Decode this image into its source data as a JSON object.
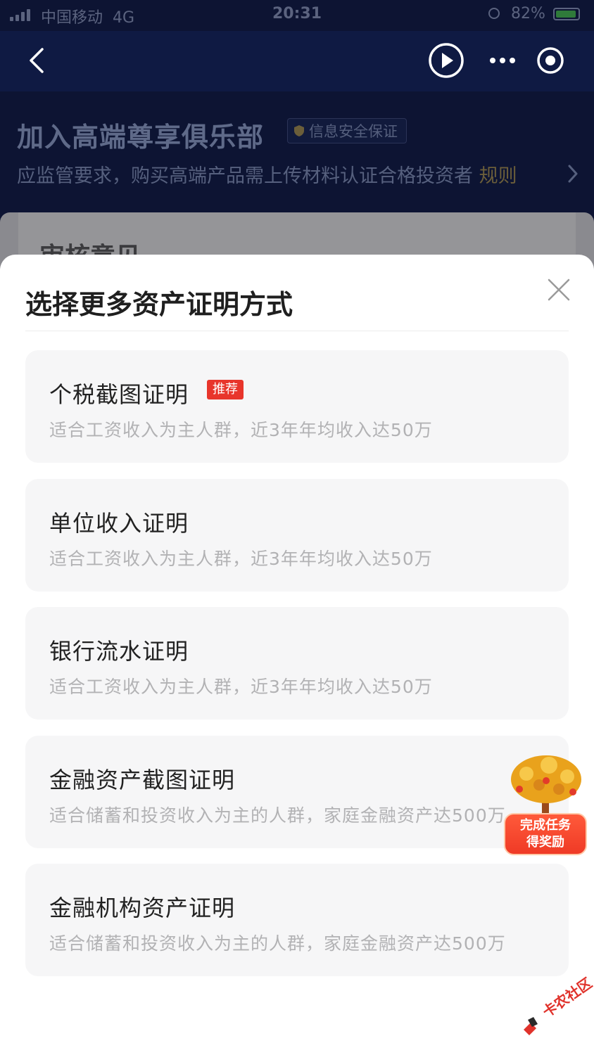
{
  "status_bar": {
    "carrier": "中国移动",
    "network": "4G",
    "time": "20:31",
    "battery": "82%"
  },
  "nav": {
    "icons": [
      "back-icon",
      "play-icon",
      "more-icon",
      "target-icon"
    ]
  },
  "header": {
    "title": "加入高端尊享俱乐部",
    "badge": "信息安全保证",
    "subtitle": "应监管要求，购买高端产品需上传材料认证合格投资者",
    "rules_link": "规则"
  },
  "background_card": {
    "title": "审核意见"
  },
  "sheet": {
    "title": "选择更多资产证明方式",
    "options": [
      {
        "title": "个税截图证明",
        "tag": "推荐",
        "desc": "适合工资收入为主人群，近3年年均收入达50万"
      },
      {
        "title": "单位收入证明",
        "desc": "适合工资收入为主人群，近3年年均收入达50万"
      },
      {
        "title": "银行流水证明",
        "desc": "适合工资收入为主人群，近3年年均收入达50万"
      },
      {
        "title": "金融资产截图证明",
        "desc": "适合储蓄和投资收入为主的人群，家庭金融资产达500万"
      },
      {
        "title": "金融机构资产证明",
        "desc": "适合储蓄和投资收入为主的人群，家庭金融资产达500万"
      }
    ]
  },
  "reward": {
    "line1": "完成任务",
    "line2": "得奖励"
  },
  "watermark": "卡农社区",
  "colors": {
    "tag_red": "#e8352b",
    "header_bg": "#0d1433",
    "sheet_bg": "#ffffff",
    "option_bg": "#f6f6f7"
  }
}
